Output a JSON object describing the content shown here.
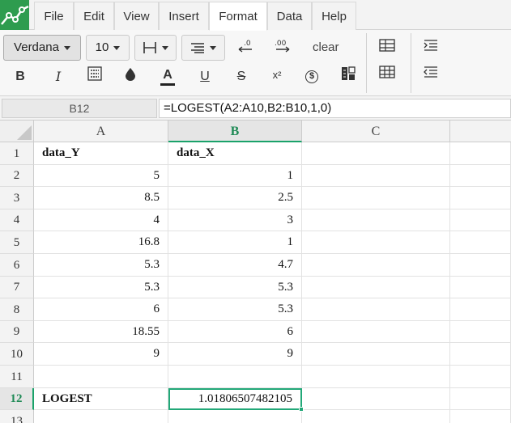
{
  "menu": {
    "items": [
      {
        "label": "File",
        "key": "file",
        "active": false
      },
      {
        "label": "Edit",
        "key": "edit",
        "active": false
      },
      {
        "label": "View",
        "key": "view",
        "active": false
      },
      {
        "label": "Insert",
        "key": "insert",
        "active": false
      },
      {
        "label": "Format",
        "key": "format",
        "active": true
      },
      {
        "label": "Data",
        "key": "data",
        "active": false
      },
      {
        "label": "Help",
        "key": "help",
        "active": false
      }
    ]
  },
  "toolbar": {
    "font_family": "Verdana",
    "font_size": "10",
    "clear_label": "clear",
    "row1_icons": [
      "borders-icon",
      "align-icon",
      "decrease-decimal-icon",
      "increase-decimal-icon"
    ],
    "row2_icons": [
      "bold-icon",
      "italic-icon",
      "background-pattern-icon",
      "fill-color-icon",
      "text-color-icon",
      "underline-icon",
      "strikethrough-icon",
      "superscript-icon",
      "currency-icon",
      "number-format-icon"
    ],
    "bold_glyph": "B",
    "italic_glyph": "I",
    "textcolor_glyph": "A",
    "underline_glyph": "U",
    "strike_glyph": "S",
    "superscript_glyph": "x²",
    "currency_glyph": "$"
  },
  "formula_bar": {
    "cell_ref": "B12",
    "formula": "=LOGEST(A2:A10,B2:B10,1,0)"
  },
  "grid": {
    "columns": [
      "A",
      "B",
      "C"
    ],
    "selected_column": "B",
    "selected_row": "12",
    "rows": [
      {
        "num": "1",
        "a": "data_Y",
        "b": "data_X",
        "header": true
      },
      {
        "num": "2",
        "a": "5",
        "b": "1"
      },
      {
        "num": "3",
        "a": "8.5",
        "b": "2.5"
      },
      {
        "num": "4",
        "a": "4",
        "b": "3"
      },
      {
        "num": "5",
        "a": "16.8",
        "b": "1"
      },
      {
        "num": "6",
        "a": "5.3",
        "b": "4.7"
      },
      {
        "num": "7",
        "a": "5.3",
        "b": "5.3"
      },
      {
        "num": "8",
        "a": "6",
        "b": "5.3"
      },
      {
        "num": "9",
        "a": "18.55",
        "b": "6"
      },
      {
        "num": "10",
        "a": "9",
        "b": "9"
      },
      {
        "num": "11",
        "a": "",
        "b": ""
      },
      {
        "num": "12",
        "a": "LOGEST",
        "b": "1.01806507482105",
        "labelrow": true
      },
      {
        "num": "13",
        "a": "",
        "b": ""
      }
    ]
  }
}
